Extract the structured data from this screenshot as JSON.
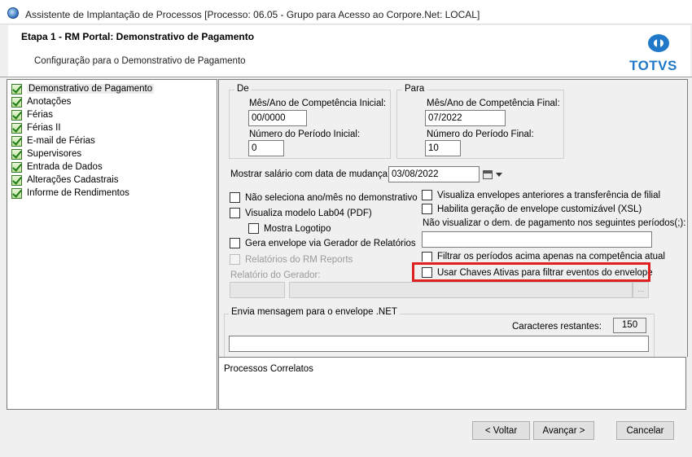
{
  "window": {
    "title": "Assistente de Implantação de Processos [Processo: 06.05 - Grupo para Acesso ao Corpore.Net: LOCAL]"
  },
  "header": {
    "step": "Etapa 1 - RM Portal: Demonstrativo de Pagamento",
    "subtitle": "Configuração para o Demonstrativo de Pagamento",
    "logo": "TOTVS"
  },
  "tree": {
    "items": [
      {
        "label": "Demonstrativo de Pagamento",
        "selected": true
      },
      {
        "label": "Anotações"
      },
      {
        "label": "Férias"
      },
      {
        "label": "Férias II"
      },
      {
        "label": "E-mail de Férias"
      },
      {
        "label": "Supervisores"
      },
      {
        "label": "Entrada de Dados"
      },
      {
        "label": "Alterações Cadastrais"
      },
      {
        "label": "Informe de Rendimentos"
      }
    ]
  },
  "de": {
    "title": "De",
    "mes_label": "Mês/Ano de Competência Inicial:",
    "mes_value": "00/0000",
    "num_label": "Número do Período Inicial:",
    "num_value": "0"
  },
  "para": {
    "title": "Para",
    "mes_label": "Mês/Ano de Competência Final:",
    "mes_value": "07/2022",
    "num_label": "Número do Período Final:",
    "num_value": "10"
  },
  "salario": {
    "label": "Mostrar salário com data de mudança até:",
    "value": "03/08/2022"
  },
  "checks_left": [
    {
      "label": "Não seleciona ano/mês no demonstrativo"
    },
    {
      "label": "Visualiza modelo Lab04 (PDF)"
    },
    {
      "label": "Mostra Logotipo"
    },
    {
      "label": "Gera envelope via Gerador de Relatórios"
    },
    {
      "label": "Relatórios do RM Reports"
    }
  ],
  "relatorio_label": "Relatório do Gerador:",
  "browse_label": "...",
  "checks_right": [
    {
      "label": "Visualiza envelopes anteriores a transferência de filial"
    },
    {
      "label": "Habilita geração de envelope customizável (XSL)"
    }
  ],
  "periodos_label": "Não visualizar o dem. de pagamento nos seguintes períodos(;):",
  "filtrar_label": "Filtrar os períodos acima apenas na competência atual",
  "chaves_label": "Usar Chaves Ativas para filtrar eventos do envelope",
  "mensagem": {
    "title": "Envia mensagem para o envelope .NET",
    "caracteres_label": "Caracteres restantes:",
    "caracteres_value": "150"
  },
  "correlatos": "Processos Correlatos",
  "buttons": {
    "voltar": "< Voltar",
    "avancar": "Avançar >",
    "cancelar": "Cancelar"
  },
  "colors": {
    "highlight": "#e02020",
    "logo": "#1f79c8"
  }
}
